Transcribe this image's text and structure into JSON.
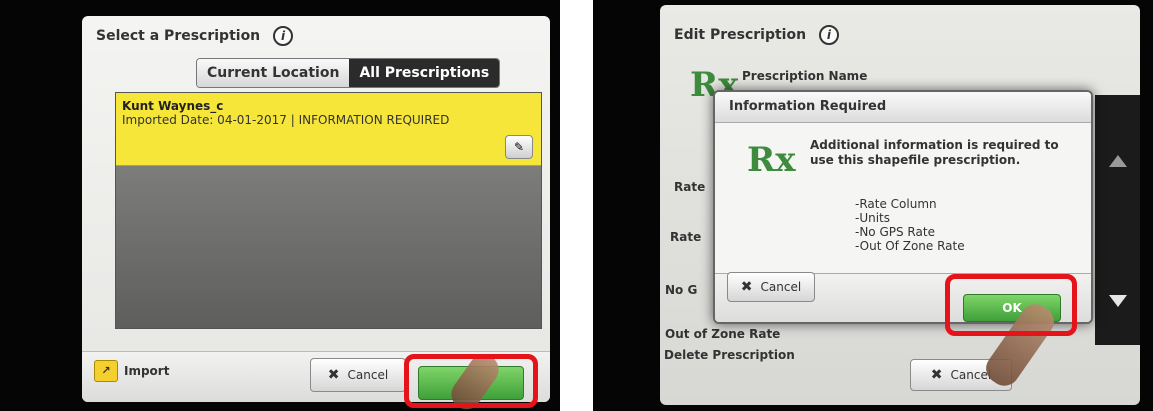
{
  "left": {
    "title": "Select a Prescription",
    "info_glyph": "i",
    "tabs": [
      {
        "label": "Current Location",
        "active": false
      },
      {
        "label": "All Prescriptions",
        "active": true
      }
    ],
    "list": [
      {
        "name": "Kunt Waynes_c",
        "subtitle": "Imported Date: 04-01-2017 | INFORMATION REQUIRED",
        "edit_glyph": "✎"
      }
    ],
    "import_label": "Import",
    "import_glyph": "↗",
    "cancel_label": "Cancel",
    "cancel_glyph": "✖",
    "ok_label": ""
  },
  "right": {
    "title": "Edit Prescription",
    "info_glyph": "i",
    "rx_symbol": "Rx",
    "prescription_name_label": "Prescription Name",
    "field_labels": [
      "Rate",
      "Rate",
      "No G",
      "Out of Zone Rate"
    ],
    "delete_label": "Delete Prescription",
    "trash_glyph": "🗑",
    "cancel_label": "Cancel",
    "cancel_glyph": "✖",
    "dialog": {
      "title": "Information Required",
      "rx_symbol": "Rx",
      "message": "Additional information is required to use this shapefile prescription.",
      "items": [
        "-Rate Column",
        "-Units",
        "-No GPS Rate",
        "-Out Of Zone Rate"
      ],
      "cancel_label": "Cancel",
      "cancel_glyph": "✖",
      "ok_label": "OK"
    }
  },
  "colors": {
    "highlight_yellow": "#f6e63a",
    "ok_green": "#4fb845",
    "callout_red": "#e5141b",
    "rx_green": "#3d8b3c"
  }
}
